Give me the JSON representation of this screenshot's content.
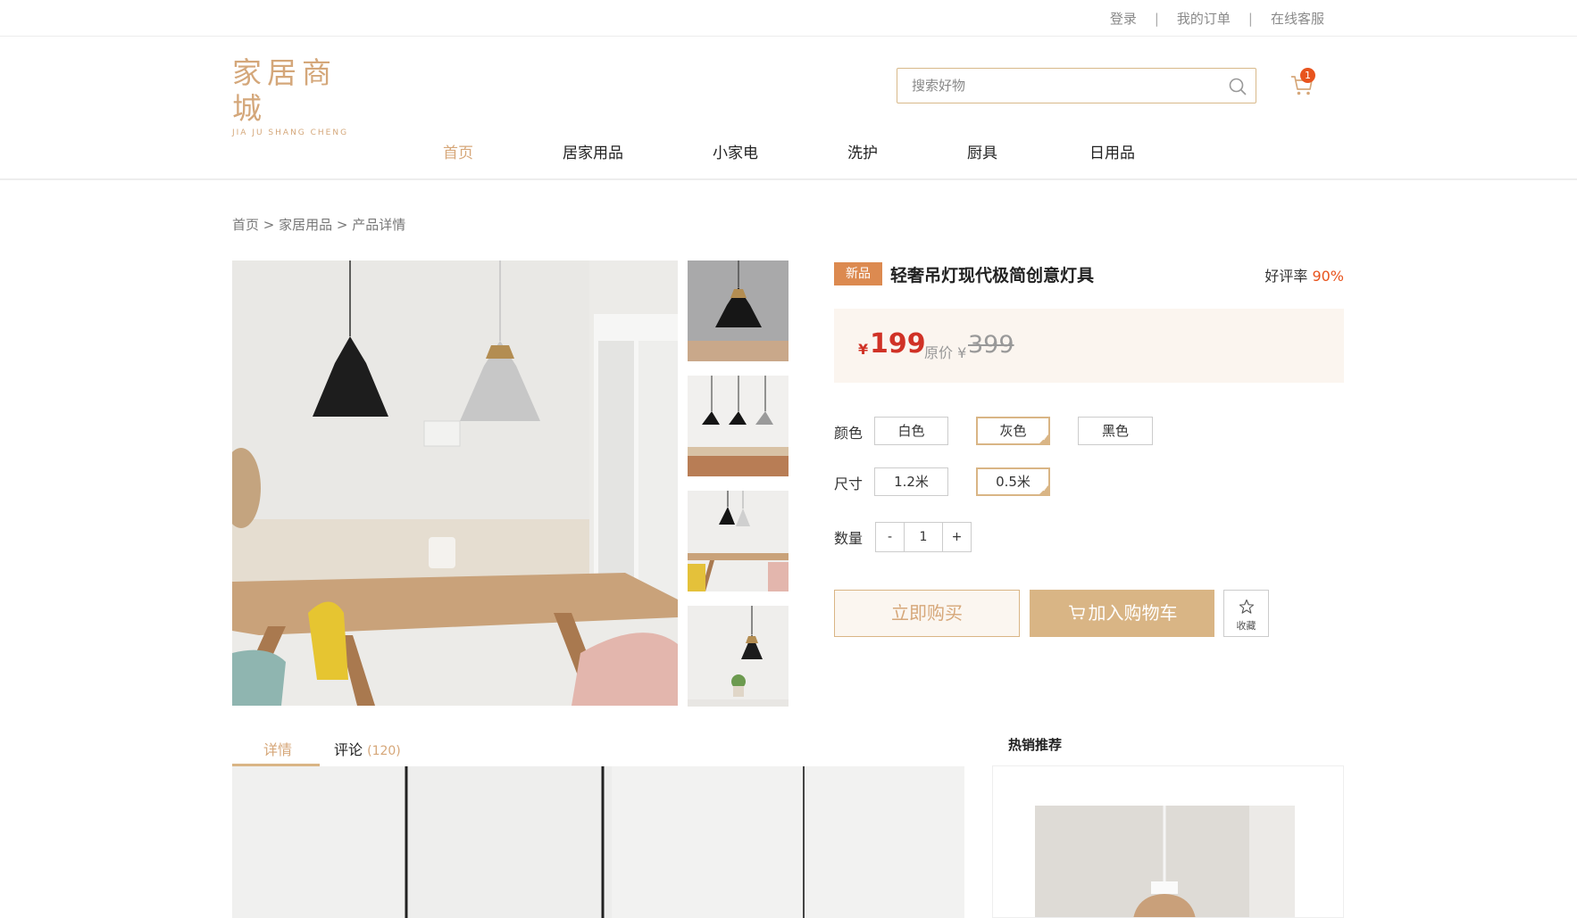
{
  "topbar": {
    "links": [
      "登录",
      "我的订单",
      "在线客服"
    ],
    "separator": "|"
  },
  "logo": {
    "cn": "家居商城",
    "en": "JIA JU SHANG CHENG"
  },
  "search": {
    "placeholder": "搜索好物",
    "value": ""
  },
  "cart": {
    "badge": "1"
  },
  "nav": {
    "items": [
      "首页",
      "居家用品",
      "小家电",
      "洗护",
      "厨具",
      "日用品"
    ],
    "active": "首页"
  },
  "breadcrumb": "首页 > 家居用品 > 产品详情",
  "product": {
    "tag": "新品",
    "title": "轻奢吊灯现代极简创意灯具",
    "rating_label": "好评率",
    "rating_value": "90%",
    "currency": "¥",
    "price": "199",
    "original_label": "原价 ¥",
    "original_price": "399"
  },
  "options": {
    "color": {
      "label": "颜色",
      "values": [
        "白色",
        "灰色",
        "黑色"
      ],
      "selected": "灰色"
    },
    "size": {
      "label": "尺寸",
      "values": [
        "1.2米",
        "0.5米"
      ],
      "selected": "0.5米"
    },
    "quantity": {
      "label": "数量",
      "minus": "-",
      "value": "1",
      "plus": "+"
    }
  },
  "actions": {
    "buy_now": "立即购买",
    "add_to_cart": "加入购物车",
    "favorite": "收藏"
  },
  "tabs": {
    "details": "详情",
    "reviews": "评论",
    "reviews_count": "(120)"
  },
  "hot": {
    "title": "热销推荐"
  },
  "colors": {
    "accent": "#d9b585",
    "accent_text": "#d6a779",
    "price": "#d03226",
    "badge": "#e8541e",
    "tag": "#dc8a50"
  }
}
